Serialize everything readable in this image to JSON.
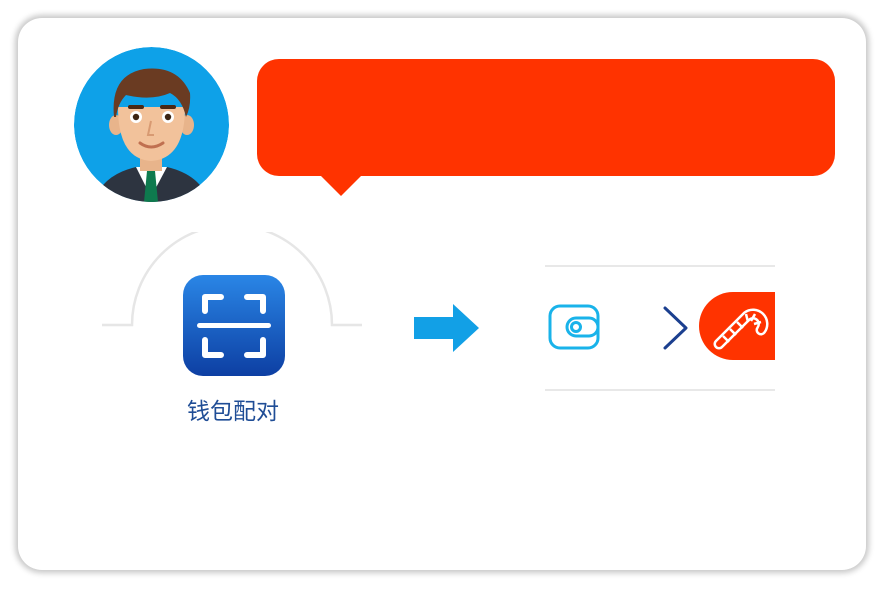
{
  "colors": {
    "bubble": "#ff3300",
    "avatar_bg": "#0ea1e8",
    "app_icon_top": "#2a86e6",
    "app_icon_bottom": "#0d3fa3",
    "arrow": "#12a0e6",
    "wallet_icon": "#19b3ea",
    "chevron": "#1b3f8f",
    "candy_pill": "#ff3300",
    "label_text": "#1f4d96"
  },
  "avatar": {
    "icon": "businessman-avatar"
  },
  "speech_bubble": {
    "text": ""
  },
  "app": {
    "icon": "scan-icon",
    "label": "钱包配对"
  },
  "flow": {
    "arrow_icon": "right-arrow-icon",
    "step_icons": [
      "wallet-icon",
      "chevron-right-icon",
      "candy-cane-icon"
    ]
  }
}
